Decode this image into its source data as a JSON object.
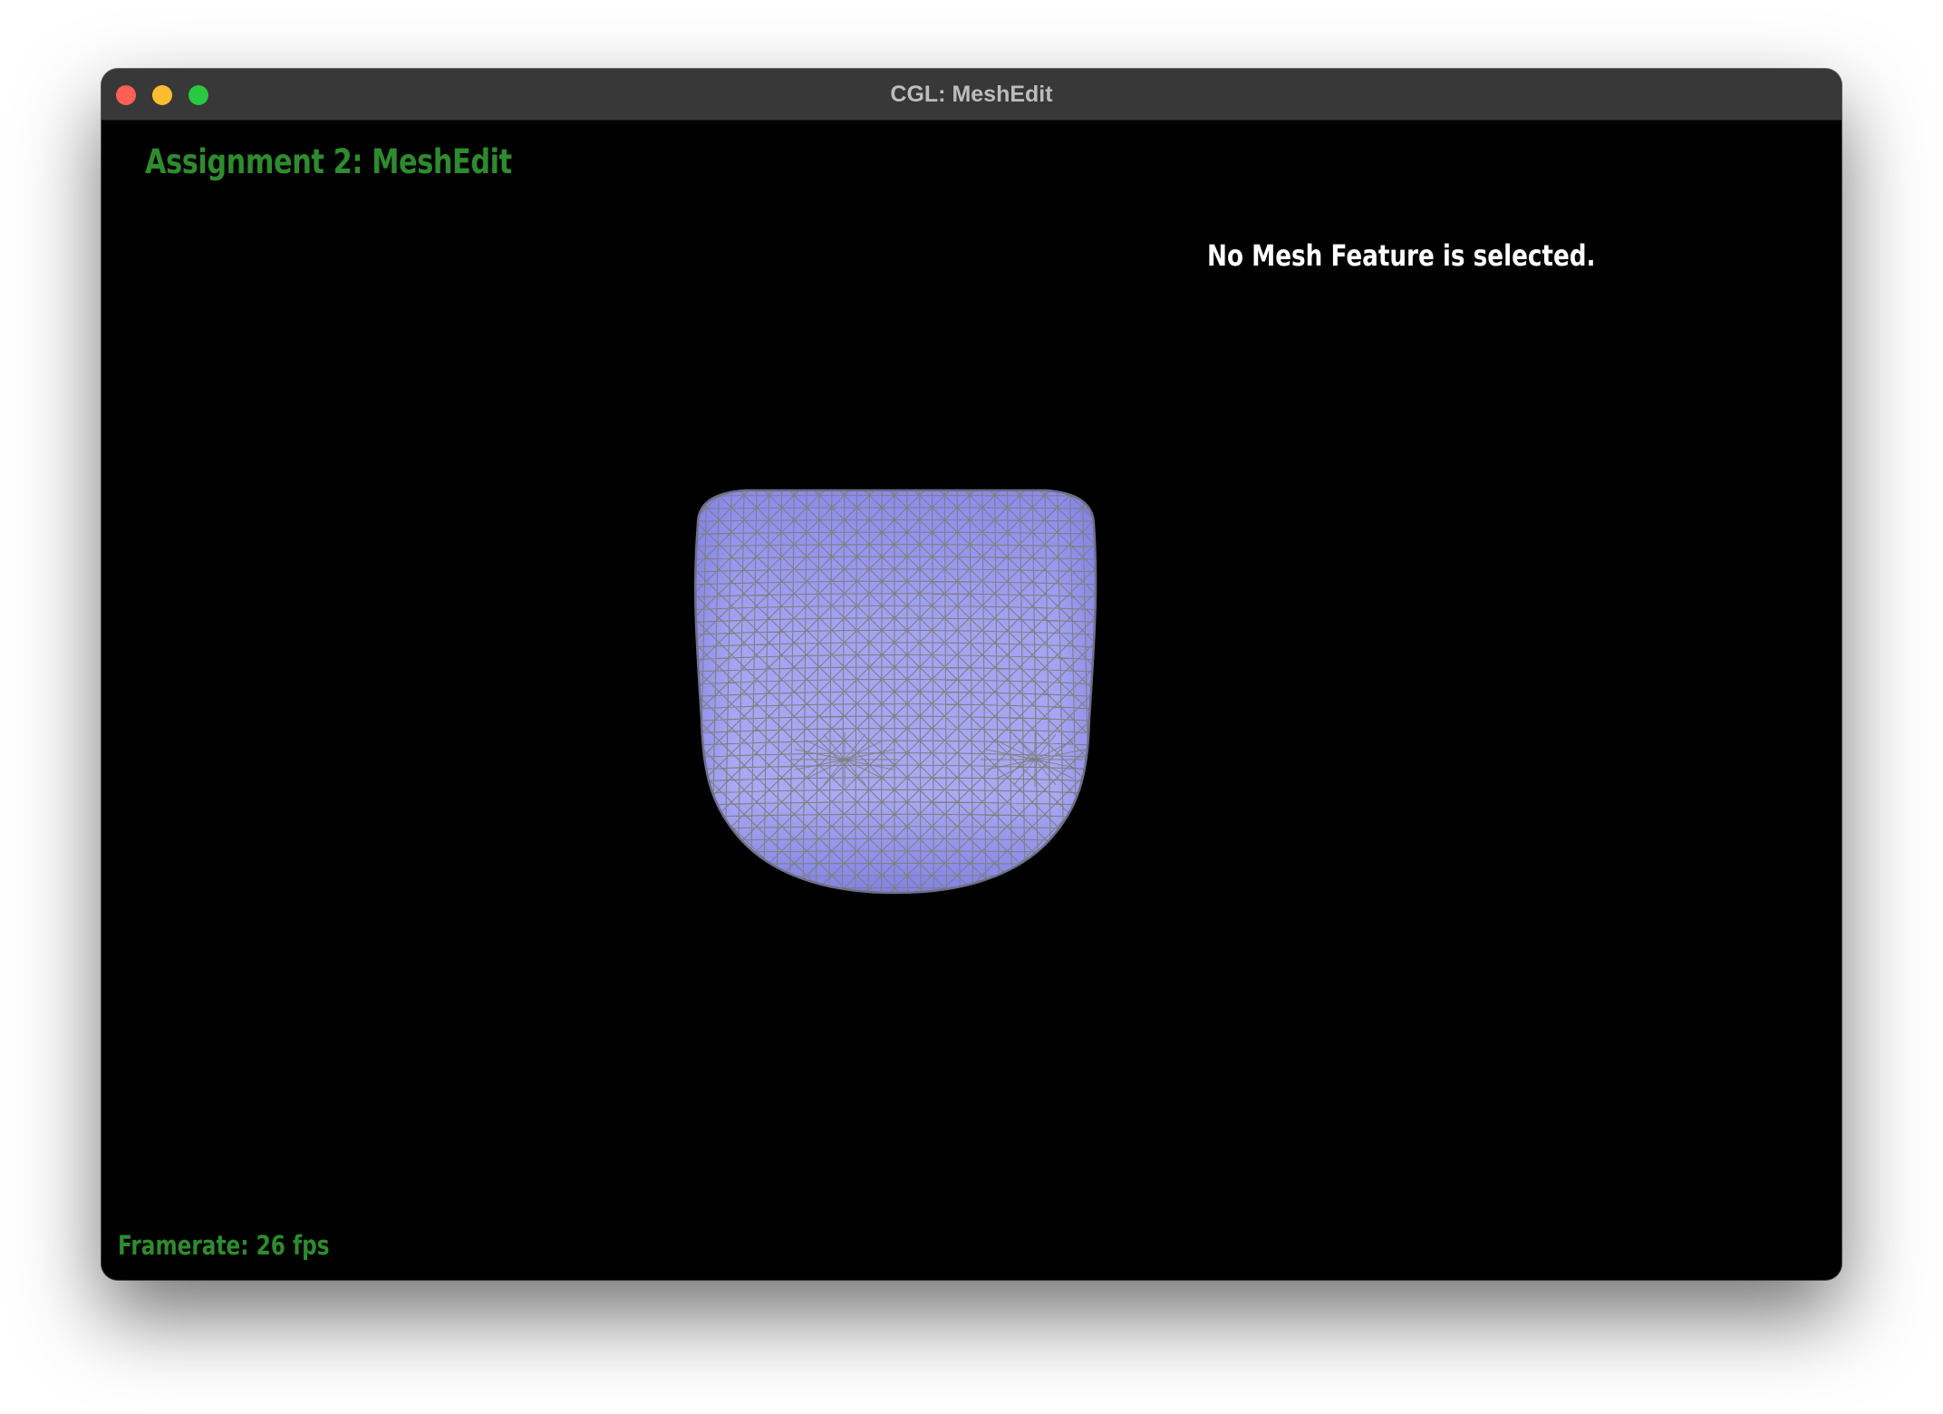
{
  "window": {
    "title": "CGL: MeshEdit"
  },
  "viewport": {
    "assignment_label": "Assignment 2: MeshEdit",
    "selection_status": "No Mesh Feature is selected.",
    "framerate_label": "Framerate: 26 fps"
  },
  "colors": {
    "mesh_fill": "#9f9ff2",
    "mesh_fill_dark": "#8080e8",
    "wireframe": "#7d7d7d",
    "hud_green": "#2e8b2e",
    "hud_white": "#ffffff",
    "background": "#000000"
  }
}
